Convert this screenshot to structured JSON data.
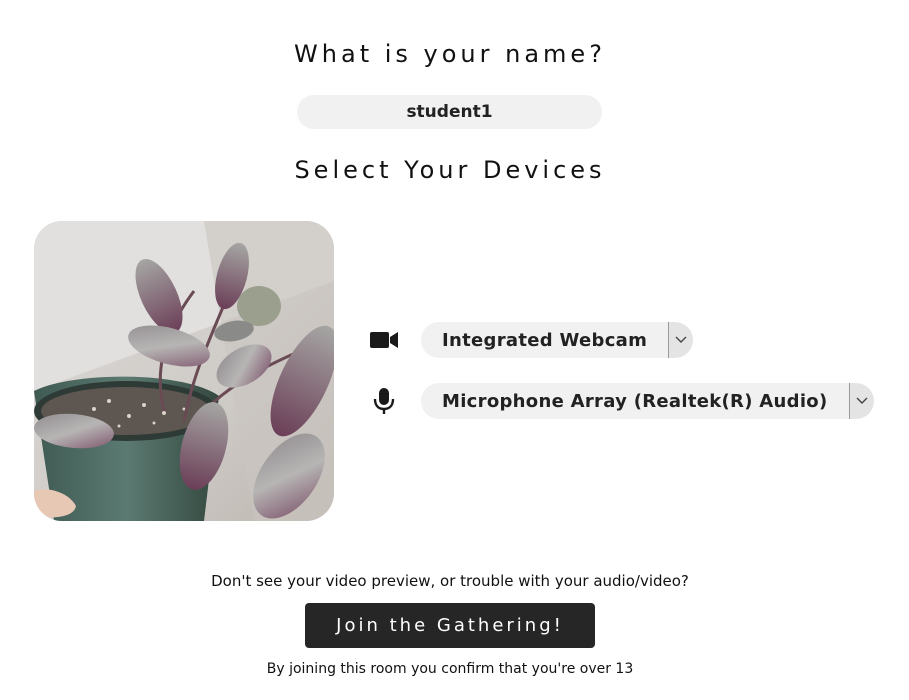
{
  "name_section": {
    "heading": "What is your name?",
    "name_value": "student1"
  },
  "devices_section": {
    "heading": "Select Your Devices",
    "camera": {
      "icon": "video-camera-icon",
      "selected": "Integrated Webcam"
    },
    "microphone": {
      "icon": "microphone-icon",
      "selected": "Microphone Array (Realtek(R) Audio)"
    }
  },
  "footer": {
    "help_text": "Don't see your video preview, or trouble with your audio/video?",
    "join_label": "Join the Gathering!",
    "age_notice": "By joining this room you confirm that you're over 13"
  },
  "colors": {
    "button_bg": "#262626",
    "field_bg": "#f1f1f1"
  }
}
